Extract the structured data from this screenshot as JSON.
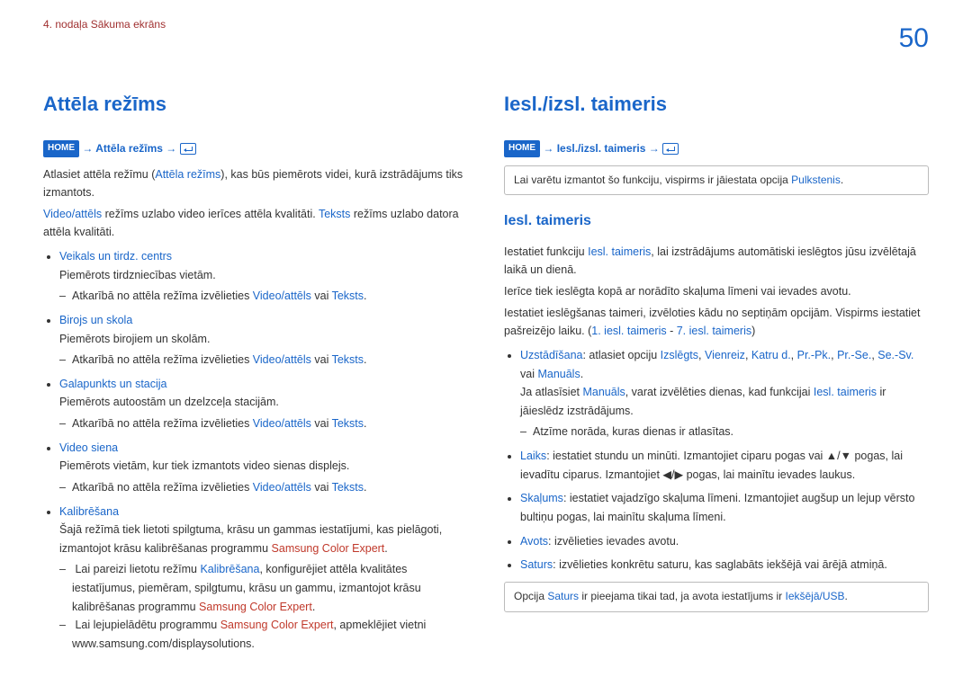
{
  "header": {
    "breadcrumb": "4. nodaļa Sākuma ekrāns",
    "page_number": "50"
  },
  "left": {
    "title": "Attēla režīms",
    "home": "HOME",
    "path_sep": "→",
    "path_link": "Attēla režīms",
    "intro_pre": "Atlasiet attēla režīmu (",
    "intro_link": "Attēla režīms",
    "intro_post": "), kas būs piemērots videi, kurā izstrādājums tiks izmantots.",
    "l2_a": "Video/attēls",
    "l2_mid1": " režīms uzlabo video ierīces attēla kvalitāti. ",
    "l2_b": "Teksts",
    "l2_mid2": " režīms uzlabo datora attēla kvalitāti.",
    "items": {
      "i1": {
        "name": "Veikals un tirdz. centrs",
        "desc": "Piemērots tirdzniecības vietām.",
        "sub_pre": "Atkarībā no attēla režīma izvēlieties ",
        "sub_a": "Video/attēls",
        "sub_mid": " vai ",
        "sub_b": "Teksts",
        "sub_end": "."
      },
      "i2": {
        "name": "Birojs un skola",
        "desc": "Piemērots birojiem un skolām.",
        "sub_pre": "Atkarībā no attēla režīma izvēlieties ",
        "sub_a": "Video/attēls",
        "sub_mid": " vai ",
        "sub_b": "Teksts",
        "sub_end": "."
      },
      "i3": {
        "name": "Galapunkts un stacija",
        "desc": "Piemērots autoostām un dzelzceļa stacijām.",
        "sub_pre": "Atkarībā no attēla režīma izvēlieties ",
        "sub_a": "Video/attēls",
        "sub_mid": " vai ",
        "sub_b": "Teksts",
        "sub_end": "."
      },
      "i4": {
        "name": "Video siena",
        "desc": "Piemērots vietām, kur tiek izmantots video sienas displejs.",
        "sub_pre": "Atkarībā no attēla režīma izvēlieties ",
        "sub_a": "Video/attēls",
        "sub_mid": " vai ",
        "sub_b": "Teksts",
        "sub_end": "."
      },
      "i5": {
        "name": "Kalibrēšana",
        "desc_pre": "Šajā režīmā tiek lietoti spilgtuma, krāsu un gammas iestatījumi, kas pielāgoti, izmantojot krāsu kalibrēšanas programmu ",
        "desc_link": "Samsung Color Expert",
        "desc_end": ".",
        "sub1_pre": "Lai pareizi lietotu režīmu ",
        "sub1_a": "Kalibrēšana",
        "sub1_mid": ", konfigurējiet attēla kvalitātes iestatījumus, piemēram, spilgtumu, krāsu un gammu, izmantojot krāsu kalibrēšanas programmu ",
        "sub1_b": "Samsung Color Expert",
        "sub1_end": ".",
        "sub2_pre": "Lai lejupielādētu programmu ",
        "sub2_a": "Samsung Color Expert",
        "sub2_mid": ", apmeklējiet vietni www.samsung.com/displaysolutions."
      }
    }
  },
  "right": {
    "title": "Iesl./izsl. taimeris",
    "home": "HOME",
    "path_sep": "→",
    "path_link": "Iesl./izsl. taimeris",
    "note1_pre": "Lai varētu izmantot šo funkciju, vispirms ir jāiestata opcija ",
    "note1_link": "Pulkstenis",
    "note1_end": ".",
    "subtitle": "Iesl. taimeris",
    "p1_pre": "Iestatiet funkciju ",
    "p1_link": "Iesl. taimeris",
    "p1_post": ", lai izstrādājums automātiski ieslēgtos jūsu izvēlētajā laikā un dienā.",
    "p2": "Ierīce tiek ieslēgta kopā ar norādīto skaļuma līmeni vai ievades avotu.",
    "p3_pre": "Iestatiet ieslēgšanas taimeri, izvēloties kādu no septiņām opcijām. Vispirms iestatiet pašreizējo laiku. (",
    "p3_a": "1. iesl. taimeris",
    "p3_mid": " - ",
    "p3_b": "7. iesl. taimeris",
    "p3_end": ")",
    "items": {
      "u": {
        "name": "Uzstādīšana",
        "pre": ": atlasiet opciju ",
        "o1": "Izslēgts",
        "o2": "Vienreiz",
        "o3": "Katru d.",
        "o4": "Pr.-Pk.",
        "o5": "Pr.-Se.",
        "o6": "Se.-Sv.",
        "mid_vai": " vai ",
        "o7": "Manuāls",
        "end": ".",
        "p2_pre": "Ja atlasīsiet ",
        "p2_a": "Manuāls",
        "p2_mid": ", varat izvēlēties dienas, kad funkcijai ",
        "p2_b": "Iesl. taimeris",
        "p2_post": " ir jāieslēdz izstrādājums.",
        "sub": "Atzīme norāda, kuras dienas ir atlasītas."
      },
      "l": {
        "name": "Laiks",
        "txt1": ": iestatiet stundu un minūti. Izmantojiet ciparu pogas vai ▲/▼ pogas, lai ievadītu ciparus. Izmantojiet ◀/▶ pogas, lai mainītu ievades laukus."
      },
      "s": {
        "name": "Skaļums",
        "txt": ": iestatiet vajadzīgo skaļuma līmeni. Izmantojiet augšup un lejup vērsto bultiņu pogas, lai mainītu skaļuma līmeni."
      },
      "a": {
        "name": "Avots",
        "txt": ": izvēlieties ievades avotu."
      },
      "sat": {
        "name": "Saturs",
        "txt": ": izvēlieties konkrētu saturu, kas saglabāts iekšējā vai ārējā atmiņā."
      }
    },
    "note2_pre": "Opcija ",
    "note2_a": "Saturs",
    "note2_mid": " ir pieejama tikai tad, ja avota iestatījums ir ",
    "note2_b": "Iekšējā/USB",
    "note2_end": "."
  }
}
